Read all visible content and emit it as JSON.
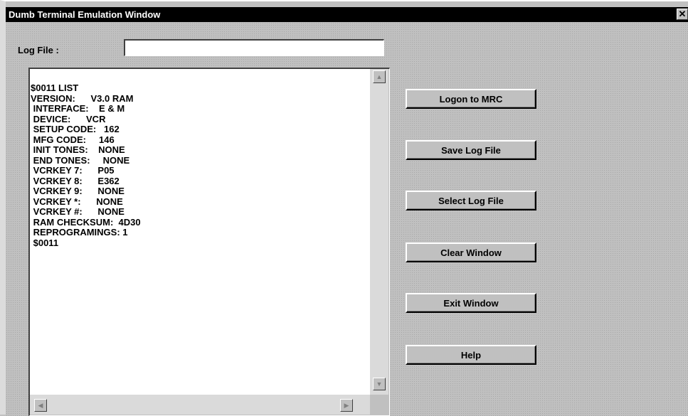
{
  "window": {
    "title": "Dumb Terminal Emulation Window",
    "close_glyph": "✕"
  },
  "log_file": {
    "label": "Log File :",
    "value": "",
    "placeholder": ""
  },
  "terminal": {
    "text": "$0011 LIST\nVERSION:      V3.0 RAM\n INTERFACE:    E & M\n DEVICE:      VCR\n SETUP CODE:   162\n MFG CODE:     146\n INIT TONES:    NONE\n END TONES:     NONE\n VCRKEY 7:      P05\n VCRKEY 8:      E362\n VCRKEY 9:      NONE\n VCRKEY *:      NONE\n VCRKEY #:      NONE\n RAM CHECKSUM:  4D30\n REPROGRAMINGS: 1\n $0011"
  },
  "buttons": {
    "logon": "Logon to MRC",
    "save_log": "Save Log File",
    "select_log": "Select Log File",
    "clear_window": "Clear Window",
    "exit_window": "Exit Window",
    "help": "Help"
  },
  "icons": {
    "scroll_up": "▲",
    "scroll_down": "▼",
    "scroll_left": "◀",
    "scroll_right": "▶"
  },
  "colors": {
    "title_bar": "#000000",
    "title_text": "#ffffff",
    "face": "#c0c0c0",
    "terminal_bg": "#ffffff"
  }
}
